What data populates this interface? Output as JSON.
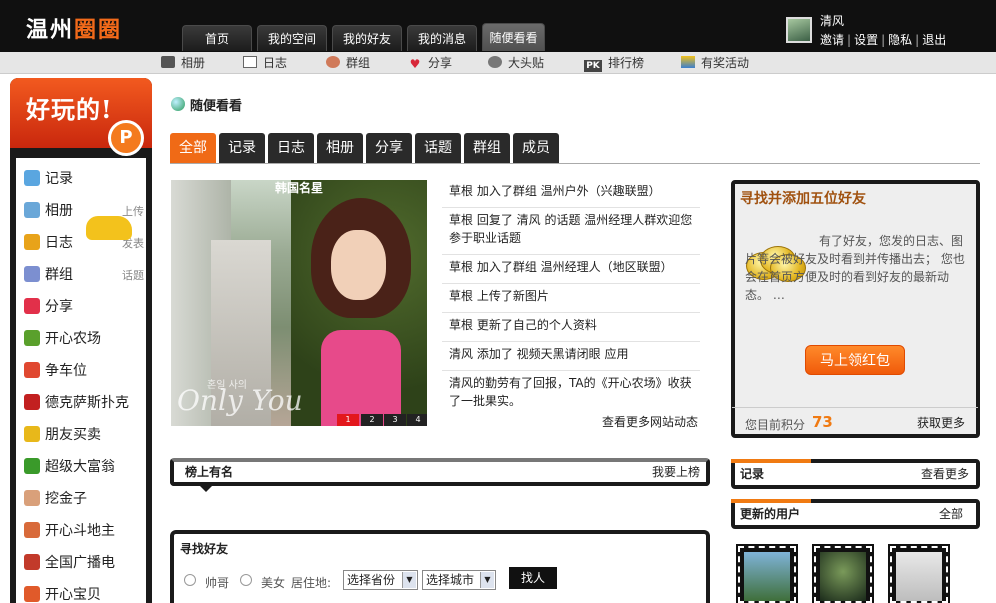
{
  "header": {
    "logo_text": "温州",
    "logo_accent": "圈圈",
    "nav_tabs": [
      "首页",
      "我的空间",
      "我的好友",
      "我的消息",
      "随便看看"
    ],
    "active_tab": "随便看看",
    "user_name": "清风",
    "user_links": [
      "邀请",
      "设置",
      "隐私",
      "退出"
    ]
  },
  "subnav": {
    "items": [
      {
        "label": "相册",
        "icon": "camera-icon"
      },
      {
        "label": "日志",
        "icon": "document-icon"
      },
      {
        "label": "群组",
        "icon": "group-icon"
      },
      {
        "label": "分享",
        "icon": "heart-icon"
      },
      {
        "label": "大头贴",
        "icon": "photo-booth-icon"
      },
      {
        "label": "排行榜",
        "icon": "pk-icon"
      },
      {
        "label": "有奖活动",
        "icon": "gift-icon"
      }
    ],
    "pk_text": "PK"
  },
  "sidebar": {
    "promo_text": "好玩的!",
    "promo_badge": "P",
    "items": [
      {
        "label": "记录",
        "extra": "",
        "icon": "chat-bubble-icon",
        "color": "#5aa6e0"
      },
      {
        "label": "相册",
        "extra": "上传",
        "icon": "photo-icon",
        "color": "#6aa7d8"
      },
      {
        "label": "日志",
        "extra": "发表",
        "icon": "notebook-icon",
        "color": "#e8a31a"
      },
      {
        "label": "群组",
        "extra": "话题",
        "icon": "group-icon",
        "color": "#7c8fd0"
      },
      {
        "label": "分享",
        "extra": "",
        "icon": "heart-icon",
        "color": "#e2304a"
      },
      {
        "label": "开心农场",
        "extra": "",
        "icon": "sprout-icon",
        "color": "#5aa02c"
      },
      {
        "label": "争车位",
        "extra": "",
        "icon": "parking-icon",
        "color": "#e04830"
      },
      {
        "label": "德克萨斯扑克",
        "extra": "",
        "icon": "poker-chip-icon",
        "color": "#c22020"
      },
      {
        "label": "朋友买卖",
        "extra": "",
        "icon": "coins-icon",
        "color": "#e8b81a"
      },
      {
        "label": "超级大富翁",
        "extra": "",
        "icon": "money-icon",
        "color": "#3a9a2a"
      },
      {
        "label": "挖金子",
        "extra": "",
        "icon": "gold-digger-icon",
        "color": "#d9a07a"
      },
      {
        "label": "开心斗地主",
        "extra": "",
        "icon": "cards-icon",
        "color": "#d86a3a"
      },
      {
        "label": "全国广播电",
        "extra": "",
        "icon": "radio-icon",
        "color": "#c23a2a"
      },
      {
        "label": "开心宝贝",
        "extra": "",
        "icon": "baby-icon",
        "color": "#e05a2a"
      }
    ]
  },
  "main": {
    "page_title": "随便看看",
    "filter_tabs": [
      "全部",
      "记录",
      "日志",
      "相册",
      "分享",
      "话题",
      "群组",
      "成员"
    ],
    "active_filter": "全部",
    "photo": {
      "caption": "韩国名星",
      "signature": "Only You",
      "signature_small": "혼일 사의",
      "pages": [
        "1",
        "2",
        "3",
        "4"
      ],
      "active_page": "1"
    },
    "feed": [
      "草根  加入了群组  温州户外（兴趣联盟）",
      "草根  回复了  清风  的话题  温州经理人群欢迎您参于职业话题",
      "草根  加入了群组  温州经理人（地区联盟）",
      "草根  上传了新图片",
      "草根  更新了自己的个人资料",
      "清风  添加了  视频天黑请闭眼  应用",
      "清风的勤劳有了回报，TA的《开心农场》收获了一批果实。"
    ],
    "feed_more": "查看更多网站动态",
    "ranked": {
      "title": "榜上有名",
      "link": "我要上榜"
    },
    "find_friends": {
      "title": "寻找好友",
      "gender_options": [
        "帅哥",
        "美女"
      ],
      "location_label": "居住地:",
      "province_select": "选择省份",
      "city_select": "选择城市",
      "button": "找人"
    }
  },
  "right": {
    "add_friends": {
      "title": "寻找并添加五位好友",
      "desc": "有了好友，您发的日志、图片等会被好友及时看到并传播出去；  您也会在首页方便及时的看到好友的最新动态。  …",
      "button": "马上领红包",
      "points_label": "您目前积分",
      "points": "73",
      "more": "获取更多"
    },
    "records": {
      "title": "记录",
      "link": "查看更多"
    },
    "updated_users": {
      "title": "更新的用户",
      "link": "全部"
    }
  },
  "colors": {
    "accent": "#f06a16",
    "dark": "#1a1a1a",
    "points": "#f07a12"
  }
}
